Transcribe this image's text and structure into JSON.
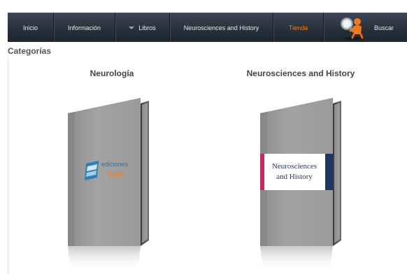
{
  "nav": {
    "items": [
      {
        "label": "Inicio"
      },
      {
        "label": "Información"
      },
      {
        "label": "Libros"
      },
      {
        "label": "Neurosciences and History"
      },
      {
        "label": "Tienda"
      },
      {
        "label": "Buscar"
      }
    ],
    "active_color": "#f0801a",
    "icon": "search-person-icon"
  },
  "categories": {
    "heading": "Categorías",
    "items": [
      {
        "title": "Neurología",
        "logo_line1": "ediciones",
        "logo_line2": "SEN",
        "cover_icon": "ediciones-sen-logo"
      },
      {
        "title": "Neurosciences and History",
        "cover_line1": "Neurosciences",
        "cover_line2": "and History"
      }
    ]
  }
}
